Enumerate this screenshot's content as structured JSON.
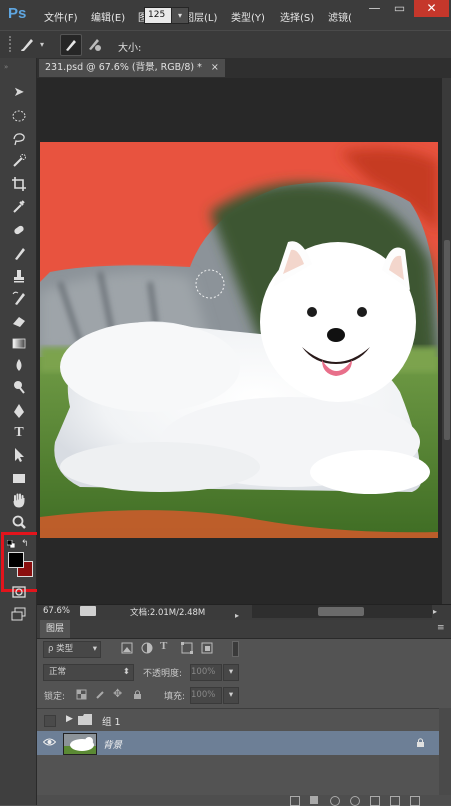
{
  "app": {
    "logo": "Ps"
  },
  "menu": {
    "items": [
      "文件(F)",
      "编辑(E)",
      "图像(I)",
      "图层(L)",
      "类型(Y)",
      "选择(S)",
      "滤镜("
    ]
  },
  "window_controls": {
    "minimize": "—",
    "restore": "▭",
    "close": "✕"
  },
  "options_bar": {
    "size_label": "大小:",
    "size_value": "125",
    "dropdown_arrow": "▾"
  },
  "document": {
    "tab_title": "231.psd @ 67.6% (背景, RGB/8) *",
    "tab_close": "×"
  },
  "status": {
    "zoom": "67.6%",
    "doc_info": "文档:2.01M/2.48M"
  },
  "layers_panel": {
    "tab_label": "图层",
    "filter_label": "ρ 类型",
    "blend_mode": "正常",
    "opacity_label": "不透明度:",
    "opacity_value": "100%",
    "lock_label": "锁定:",
    "fill_label": "填充:",
    "fill_value": "100%",
    "layers": [
      {
        "name": "组 1",
        "type": "group",
        "visible": false
      },
      {
        "name": "背景",
        "type": "image",
        "visible": true,
        "locked": true,
        "selected": true
      }
    ]
  },
  "colors": {
    "accent_highlight": "#e3141c",
    "foreground_swatch": "#000000",
    "background_swatch": "#8a0f0f",
    "quick_mask_overlay": "#e8533f",
    "selected_layer": "#6d7f96"
  },
  "icons": [
    "move-icon",
    "marquee-icon",
    "lasso-icon",
    "quick-select-icon",
    "crop-icon",
    "eyedropper-icon",
    "healing-icon",
    "brush-icon",
    "stamp-icon",
    "history-brush-icon",
    "eraser-icon",
    "gradient-icon",
    "blur-icon",
    "dodge-icon",
    "pen-icon",
    "type-icon",
    "path-select-icon",
    "rectangle-icon",
    "hand-icon",
    "zoom-icon",
    "quick-mask-icon",
    "screen-mode-icon"
  ]
}
